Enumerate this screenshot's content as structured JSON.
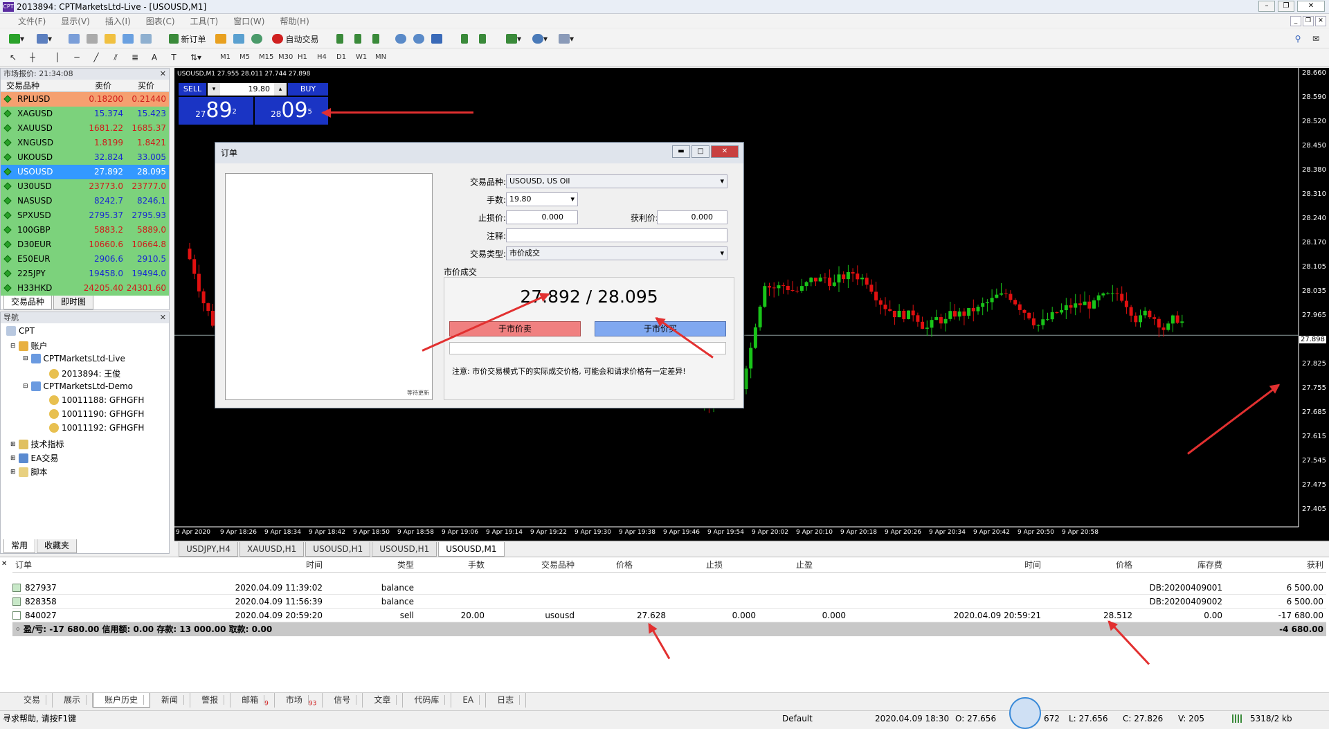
{
  "window": {
    "title": "2013894: CPTMarketsLtd-Live - [USOUSD,M1]"
  },
  "menu": [
    "文件(F)",
    "显示(V)",
    "插入(I)",
    "图表(C)",
    "工具(T)",
    "窗口(W)",
    "帮助(H)"
  ],
  "toolbar": {
    "new_order": "新订单",
    "auto_trade": "自动交易",
    "timeframes": [
      "M1",
      "M5",
      "M15",
      "M30",
      "H1",
      "H4",
      "D1",
      "W1",
      "MN"
    ]
  },
  "market_watch": {
    "title": "市场报价: 21:34:08",
    "col_symbol": "交易品种",
    "col_bid": "卖价",
    "col_ask": "买价",
    "rows": [
      {
        "sym": "RPLUSD",
        "bid": "0.18200",
        "ask": "0.21440",
        "style": "orange"
      },
      {
        "sym": "XAGUSD",
        "bid": "15.374",
        "ask": "15.423",
        "style": "blue"
      },
      {
        "sym": "XAUUSD",
        "bid": "1681.22",
        "ask": "1685.37",
        "style": "red"
      },
      {
        "sym": "XNGUSD",
        "bid": "1.8199",
        "ask": "1.8421",
        "style": "red"
      },
      {
        "sym": "UKOUSD",
        "bid": "32.824",
        "ask": "33.005",
        "style": "blue"
      },
      {
        "sym": "USOUSD",
        "bid": "27.892",
        "ask": "28.095",
        "style": "selected"
      },
      {
        "sym": "U30USD",
        "bid": "23773.0",
        "ask": "23777.0",
        "style": "red"
      },
      {
        "sym": "NASUSD",
        "bid": "8242.7",
        "ask": "8246.1",
        "style": "blue"
      },
      {
        "sym": "SPXUSD",
        "bid": "2795.37",
        "ask": "2795.93",
        "style": "blue"
      },
      {
        "sym": "100GBP",
        "bid": "5883.2",
        "ask": "5889.0",
        "style": "red"
      },
      {
        "sym": "D30EUR",
        "bid": "10660.6",
        "ask": "10664.8",
        "style": "red"
      },
      {
        "sym": "E50EUR",
        "bid": "2906.6",
        "ask": "2910.5",
        "style": "blue"
      },
      {
        "sym": "225JPY",
        "bid": "19458.0",
        "ask": "19494.0",
        "style": "blue"
      },
      {
        "sym": "H33HKD",
        "bid": "24205.40",
        "ask": "24301.60",
        "style": "red"
      }
    ],
    "tabs": [
      "交易品种",
      "即时图"
    ]
  },
  "navigator": {
    "title": "导航",
    "root": "CPT",
    "accounts": "账户",
    "live": "CPTMarketsLtd-Live",
    "live_acc": "2013894: 王俊",
    "demo": "CPTMarketsLtd-Demo",
    "demo1": "10011188: GFHGFH",
    "demo2": "10011190: GFHGFH",
    "demo3": "10011192: GFHGFH",
    "indicators": "技术指标",
    "ea": "EA交易",
    "scripts": "脚本",
    "tabs": [
      "常用",
      "收藏夹"
    ]
  },
  "chart": {
    "header": "USOUSD,M1  27.955 28.011 27.744 27.898",
    "sell_label": "SELL",
    "buy_label": "BUY",
    "lot": "19.80",
    "sell_small": "27",
    "sell_big": "89",
    "sell_sup": "2",
    "buy_small": "28",
    "buy_big": "09",
    "buy_sup": "5",
    "price_ticks": [
      "28.660",
      "28.590",
      "28.520",
      "28.450",
      "28.380",
      "28.310",
      "28.240",
      "28.170",
      "28.105",
      "28.035",
      "27.965",
      "27.898",
      "27.825",
      "27.755",
      "27.685",
      "27.615",
      "27.545",
      "27.475",
      "27.405"
    ],
    "time_ticks": [
      "9 Apr 2020",
      "9 Apr 18:26",
      "9 Apr 18:34",
      "9 Apr 18:42",
      "9 Apr 18:50",
      "9 Apr 18:58",
      "9 Apr 19:06",
      "9 Apr 19:14",
      "9 Apr 19:22",
      "9 Apr 19:30",
      "9 Apr 19:38",
      "9 Apr 19:46",
      "9 Apr 19:54",
      "9 Apr 20:02",
      "9 Apr 20:10",
      "9 Apr 20:18",
      "9 Apr 20:26",
      "9 Apr 20:34",
      "9 Apr 20:42",
      "9 Apr 20:50",
      "9 Apr 20:58"
    ],
    "tabs": [
      "USDJPY,H4",
      "XAUUSD,H1",
      "USOUSD,H1",
      "USOUSD,H1",
      "USOUSD,M1"
    ]
  },
  "order_dialog": {
    "title": "订单",
    "symbol_label": "交易品种:",
    "symbol_value": "USOUSD, US Oil",
    "volume_label": "手数:",
    "volume_value": "19.80",
    "sl_label": "止损价:",
    "sl_value": "0.000",
    "tp_label": "获利价:",
    "tp_value": "0.000",
    "comment_label": "注释:",
    "type_label": "交易类型:",
    "type_value": "市价成交",
    "section_label": "市价成交",
    "quote": "27.892 / 28.095",
    "sell_btn": "于市价卖",
    "buy_btn": "于市价买",
    "note": "注意: 市价交易模式下的实际成交价格, 可能会和请求价格有一定差异!",
    "waiting": "等待更新"
  },
  "terminal": {
    "headers": [
      "订单",
      "时间",
      "类型",
      "手数",
      "交易品种",
      "价格",
      "止损",
      "止盈",
      "时间",
      "价格",
      "库存费",
      "获利"
    ],
    "rows": [
      {
        "order": "827937",
        "time": "2020.04.09 11:39:02",
        "type": "balance",
        "lots": "",
        "sym": "",
        "price": "",
        "sl": "",
        "tp": "",
        "time2": "",
        "price2": "",
        "swap": "DB:20200409001",
        "profit": "6 500.00"
      },
      {
        "order": "828358",
        "time": "2020.04.09 11:56:39",
        "type": "balance",
        "lots": "",
        "sym": "",
        "price": "",
        "sl": "",
        "tp": "",
        "time2": "",
        "price2": "",
        "swap": "DB:20200409002",
        "profit": "6 500.00"
      },
      {
        "order": "840027",
        "time": "2020.04.09 20:59:20",
        "type": "sell",
        "lots": "20.00",
        "sym": "usousd",
        "price": "27.628",
        "sl": "0.000",
        "tp": "0.000",
        "time2": "2020.04.09 20:59:21",
        "price2": "28.512",
        "swap": "0.00",
        "profit": "-17 680.00"
      }
    ],
    "summary": "盈/亏: -17 680.00  信用额: 0.00  存款: 13 000.00  取款: 0.00",
    "summary_total": "-4 680.00",
    "tabs": [
      "交易",
      "展示",
      "账户历史",
      "新闻",
      "警报",
      "邮箱",
      "市场",
      "信号",
      "文章",
      "代码库",
      "EA",
      "日志"
    ],
    "mail_count": "9",
    "market_count": "93"
  },
  "status": {
    "help": "寻求帮助, 请按F1键",
    "profile": "Default",
    "datetime": "2020.04.09 18:30",
    "open": "O: 27.656",
    "high": "672",
    "low": "L: 27.656",
    "close": "C: 27.826",
    "volume": "V: 205",
    "traffic": "5318/2 kb"
  },
  "colors": {
    "bull": "#19c419",
    "bear": "#e01010",
    "accent": "#1a34c4"
  }
}
